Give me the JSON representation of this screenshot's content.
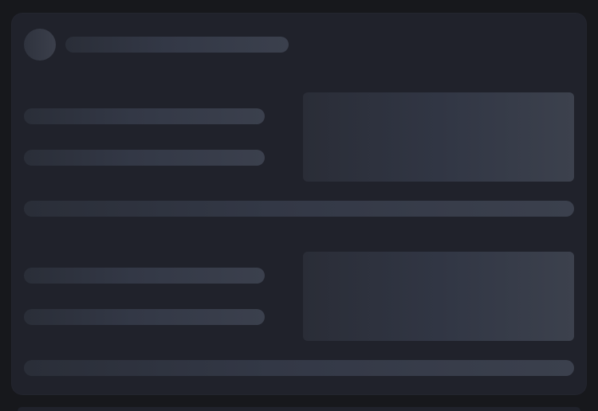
{
  "screen": {
    "name": "loading-skeleton",
    "background_color": "#17181c",
    "card_color": "#20222b",
    "skeleton_gradient": [
      "#2a2e38",
      "#333846",
      "#3b404d"
    ]
  },
  "skeleton": {
    "header": {
      "avatar_icon": "avatar-placeholder-icon",
      "title_placeholder": ""
    },
    "sections": [
      {
        "lines": [
          "",
          ""
        ],
        "image_placeholder": "",
        "full_line": ""
      },
      {
        "lines": [
          "",
          ""
        ],
        "image_placeholder": "",
        "full_line": ""
      }
    ]
  }
}
